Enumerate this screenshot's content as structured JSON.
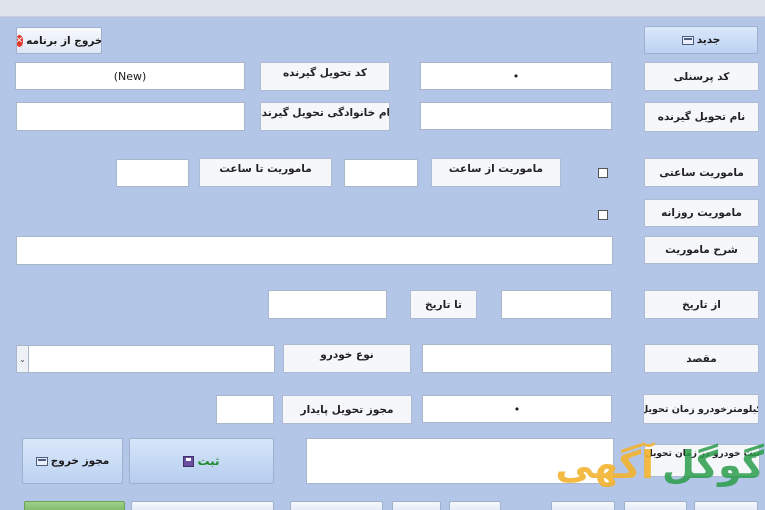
{
  "buttons": {
    "new_label": "جدید",
    "exit_program_label": "خروج از برنامه",
    "submit_label": "ثبت",
    "exit_permit_label": "مجوز خروج"
  },
  "labels": {
    "personnel_code": "کد پرسنلی",
    "receiver_code": "کد تحویل گیرنده",
    "receiver_name": "نام تحویل گیرنده",
    "receiver_family": "نام خانوادگی تحویل گیرنده",
    "hourly_mission": "ماموریت ساعتی",
    "mission_from_hour": "ماموریت از ساعت",
    "mission_to_hour": "ماموریت تا ساعت",
    "daily_mission": "ماموریت روزانه",
    "mission_description": "شرح ماموریت",
    "from_date": "از تاریخ",
    "to_date": "تا تاریخ",
    "destination": "مقصد",
    "vehicle_type": "نوع خودرو",
    "km_at_delivery": "کیلومترخودرو  زمان تحویل",
    "delivery_permit_base": "مجوز تحویل پایدار",
    "vehicle_state_at_delivery": "وضعیت خودرو در زمان تحویل"
  },
  "values": {
    "personnel_code": "•",
    "receiver_code": "(New)",
    "km_at_delivery": "•"
  },
  "watermark": {
    "part1": "گوگل",
    "part2": "آگهی"
  }
}
